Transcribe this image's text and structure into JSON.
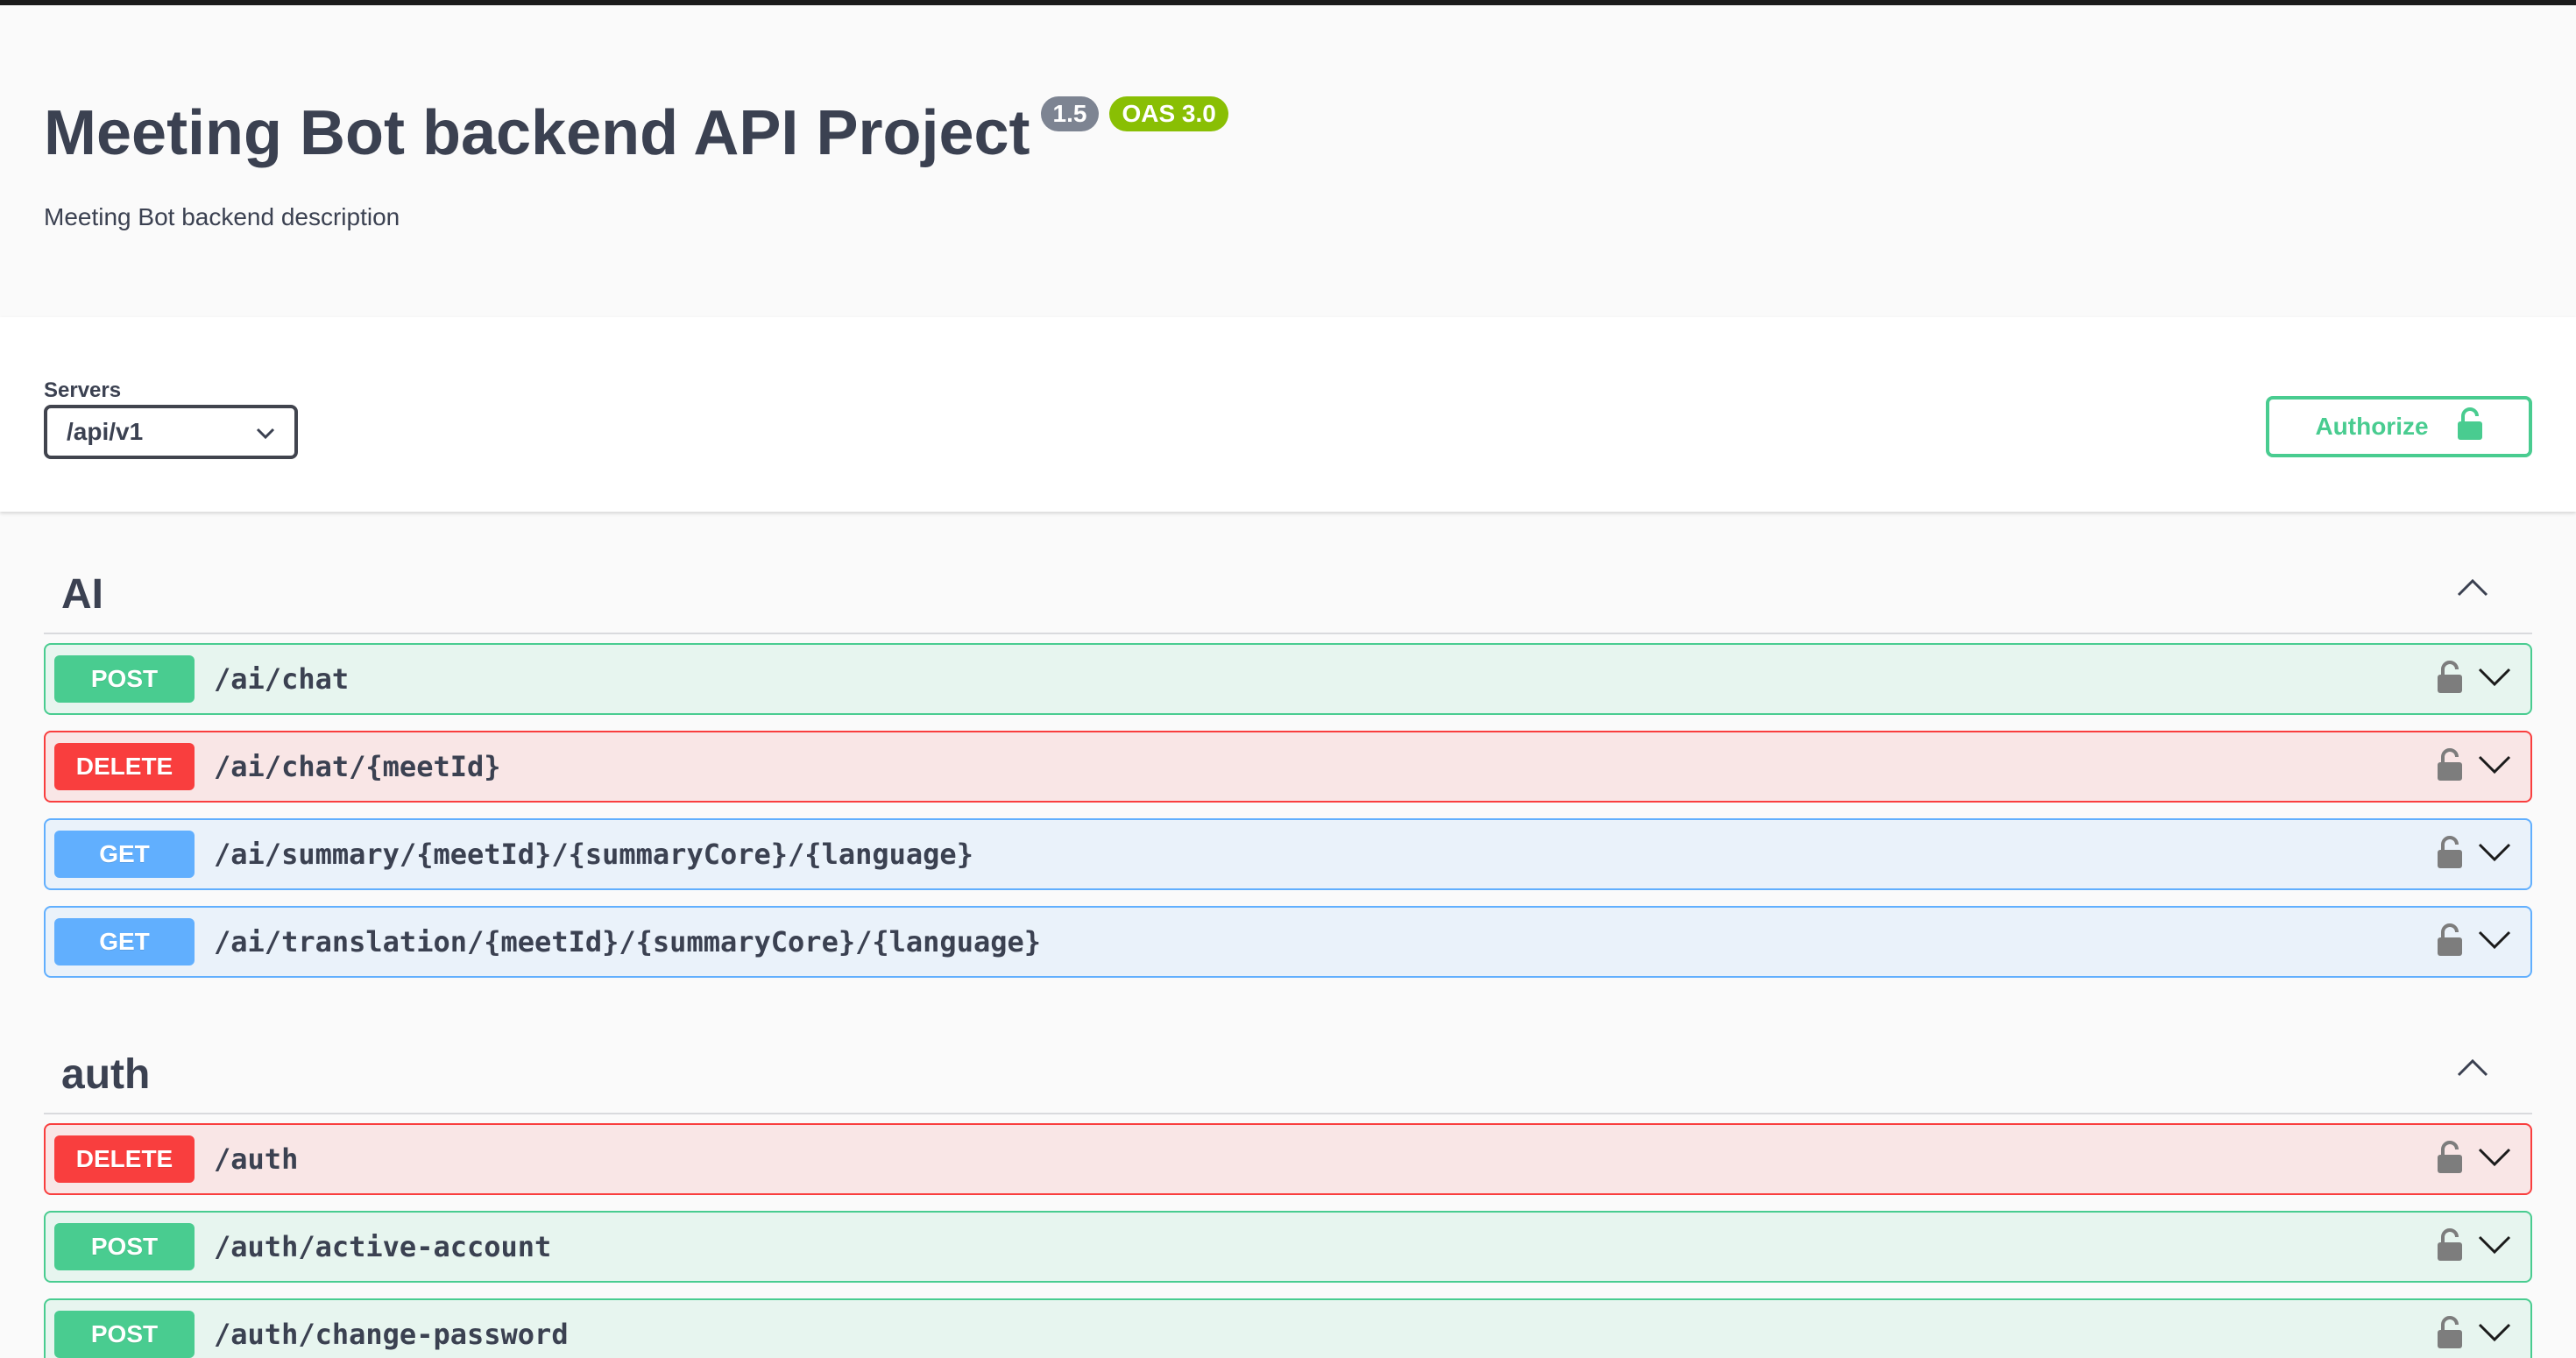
{
  "info": {
    "title": "Meeting Bot backend API Project",
    "version": "1.5",
    "oas": "OAS 3.0",
    "description": "Meeting Bot backend description"
  },
  "servers": {
    "label": "Servers",
    "selected": "/api/v1"
  },
  "authorize": {
    "label": "Authorize"
  },
  "tags": [
    {
      "name": "AI",
      "operations": [
        {
          "method": "POST",
          "path": "/ai/chat"
        },
        {
          "method": "DELETE",
          "path": "/ai/chat/{meetId}"
        },
        {
          "method": "GET",
          "path": "/ai/summary/{meetId}/{summaryCore}/{language}"
        },
        {
          "method": "GET",
          "path": "/ai/translation/{meetId}/{summaryCore}/{language}"
        }
      ]
    },
    {
      "name": "auth",
      "operations": [
        {
          "method": "DELETE",
          "path": "/auth"
        },
        {
          "method": "POST",
          "path": "/auth/active-account"
        },
        {
          "method": "POST",
          "path": "/auth/change-password"
        }
      ]
    }
  ],
  "colors": {
    "post": "#49cc90",
    "delete": "#f93e3e",
    "get": "#61affe",
    "authorize": "#49cc90",
    "version_badge": "#7d8492",
    "oas_badge": "#89bf04"
  }
}
